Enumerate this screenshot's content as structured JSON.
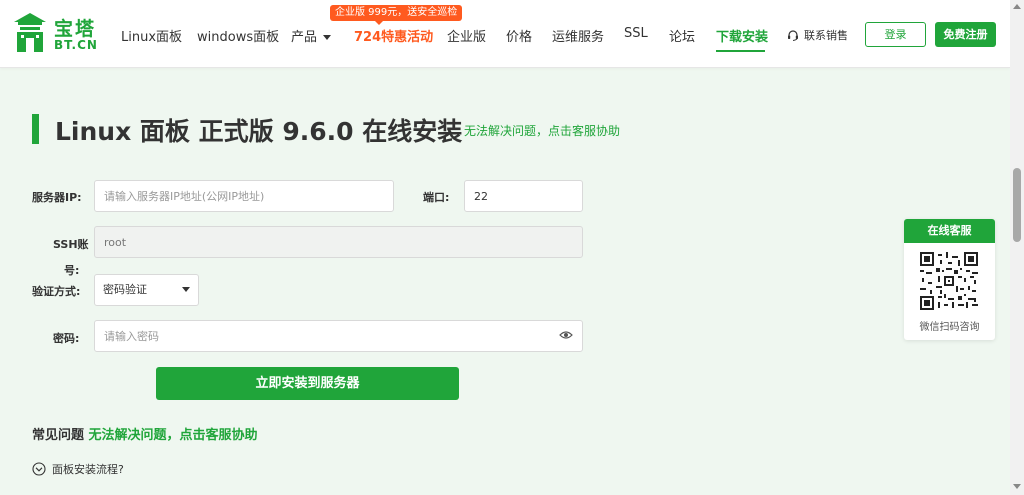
{
  "brand": {
    "name": "宝塔",
    "sub": "BT.CN",
    "color": "#20a53a"
  },
  "nav": {
    "promo_badge": "企业版 999元，送安全巡检",
    "items": [
      {
        "label": "Linux面板"
      },
      {
        "label": "windows面板"
      },
      {
        "label": "产品"
      },
      {
        "label": "724特惠活动"
      },
      {
        "label": "企业版"
      },
      {
        "label": "价格"
      },
      {
        "label": "运维服务"
      },
      {
        "label": "SSL"
      },
      {
        "label": "论坛"
      },
      {
        "label": "下载安装"
      }
    ],
    "sales": "联系销售",
    "login": "登录",
    "register": "免费注册"
  },
  "page": {
    "title": "Linux 面板 正式版 9.6.0 在线安装",
    "help_link": "无法解决问题，点击客服协助"
  },
  "form": {
    "server_ip_label": "服务器IP:",
    "server_ip_placeholder": "请输入服务器IP地址(公网IP地址)",
    "port_label": "端口:",
    "port_value": "22",
    "ssh_label_line1": "SSH账",
    "ssh_label_line2": "号:",
    "ssh_value": "root",
    "auth_label": "验证方式:",
    "auth_selected": "密码验证",
    "password_label": "密码:",
    "password_placeholder": "请输入密码",
    "install_button": "立即安装到服务器"
  },
  "faq": {
    "title": "常见问题",
    "help_link": "无法解决问题，点击客服协助",
    "items": [
      {
        "label": "面板安装流程?"
      }
    ]
  },
  "service": {
    "title": "在线客服",
    "caption": "微信扫码咨询"
  }
}
